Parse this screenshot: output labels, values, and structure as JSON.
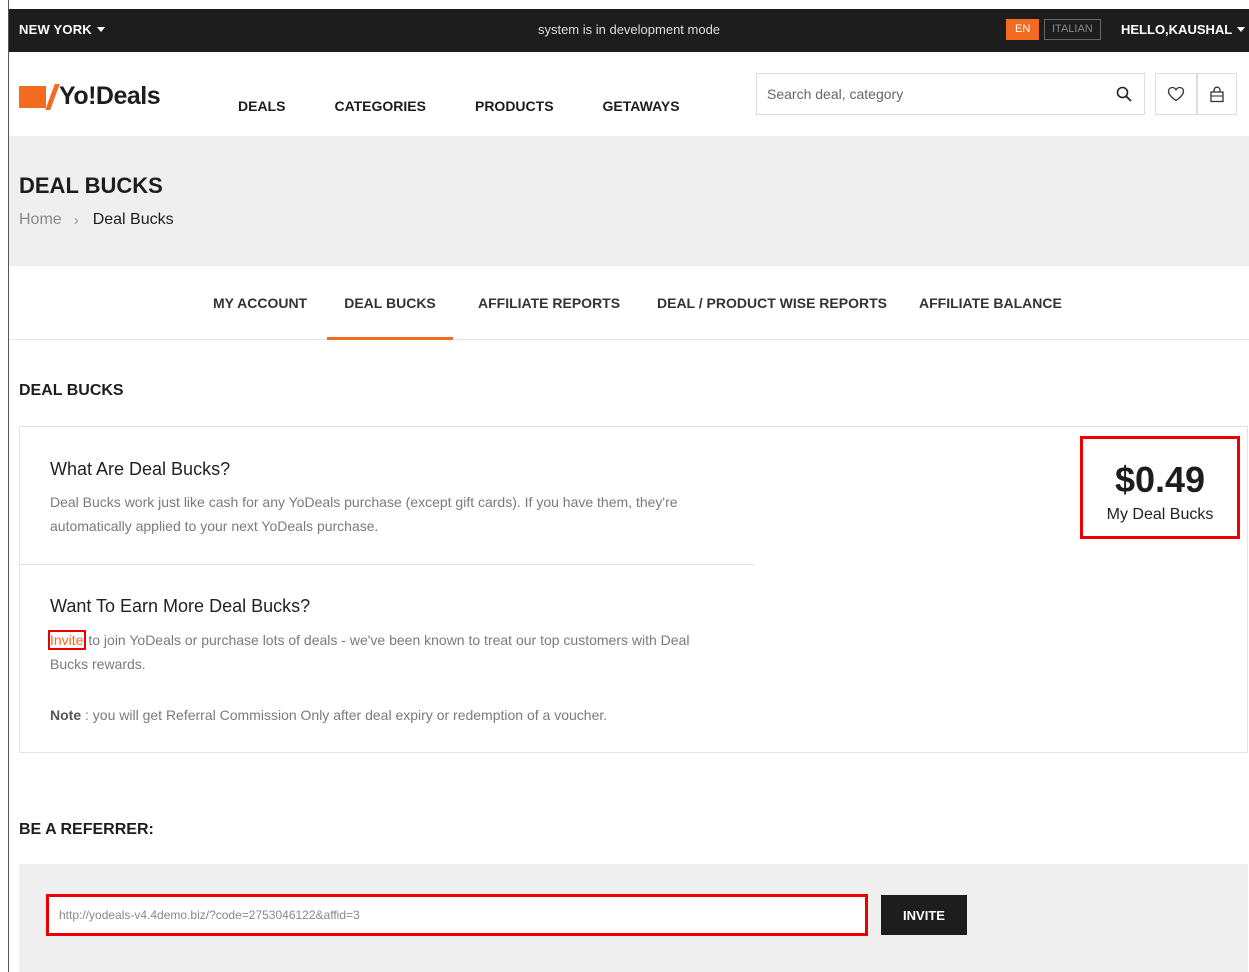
{
  "topbar": {
    "city": "NEW YORK",
    "dev_notice": "system is in development mode",
    "lang_active": "EN",
    "lang_other": "ITALIAN",
    "greeting": "HELLO,KAUSHAL"
  },
  "header": {
    "logo_text": "Yo!Deals",
    "nav": [
      "DEALS",
      "CATEGORIES",
      "PRODUCTS",
      "GETAWAYS"
    ],
    "search_placeholder": "Search deal, category"
  },
  "hero": {
    "title": "DEAL BUCKS",
    "breadcrumb_home": "Home",
    "breadcrumb_current": "Deal Bucks"
  },
  "tabs": [
    {
      "label": "MY ACCOUNT",
      "active": false
    },
    {
      "label": "DEAL BUCKS",
      "active": true
    },
    {
      "label": "AFFILIATE REPORTS",
      "active": false
    },
    {
      "label": "DEAL / PRODUCT WISE REPORTS",
      "active": false
    },
    {
      "label": "AFFILIATE BALANCE",
      "active": false
    }
  ],
  "section_title": "DEAL BUCKS",
  "what": {
    "title": "What Are Deal Bucks?",
    "text": "Deal Bucks work just like cash for any YoDeals purchase (except gift cards). If you have them, they're automatically applied to your next YoDeals purchase."
  },
  "earn": {
    "title": "Want To Earn More Deal Bucks?",
    "invite_link": "Invite",
    "text": " to join YoDeals or purchase lots of deals - we've been known to treat our top customers with Deal Bucks rewards.",
    "note_label": "Note",
    "note_text": " : you will get Referral Commission Only after deal expiry or redemption of a voucher."
  },
  "balance": {
    "amount": "$0.49",
    "label": "My Deal Bucks"
  },
  "referrer": {
    "title": "BE A REFERRER:",
    "url": "http://yodeals-v4.4demo.biz/?code=2753046122&affid=3",
    "button": "INVITE"
  },
  "colors": {
    "accent": "#f26b21",
    "dark": "#1d1d1d",
    "highlight": "#e00000"
  }
}
